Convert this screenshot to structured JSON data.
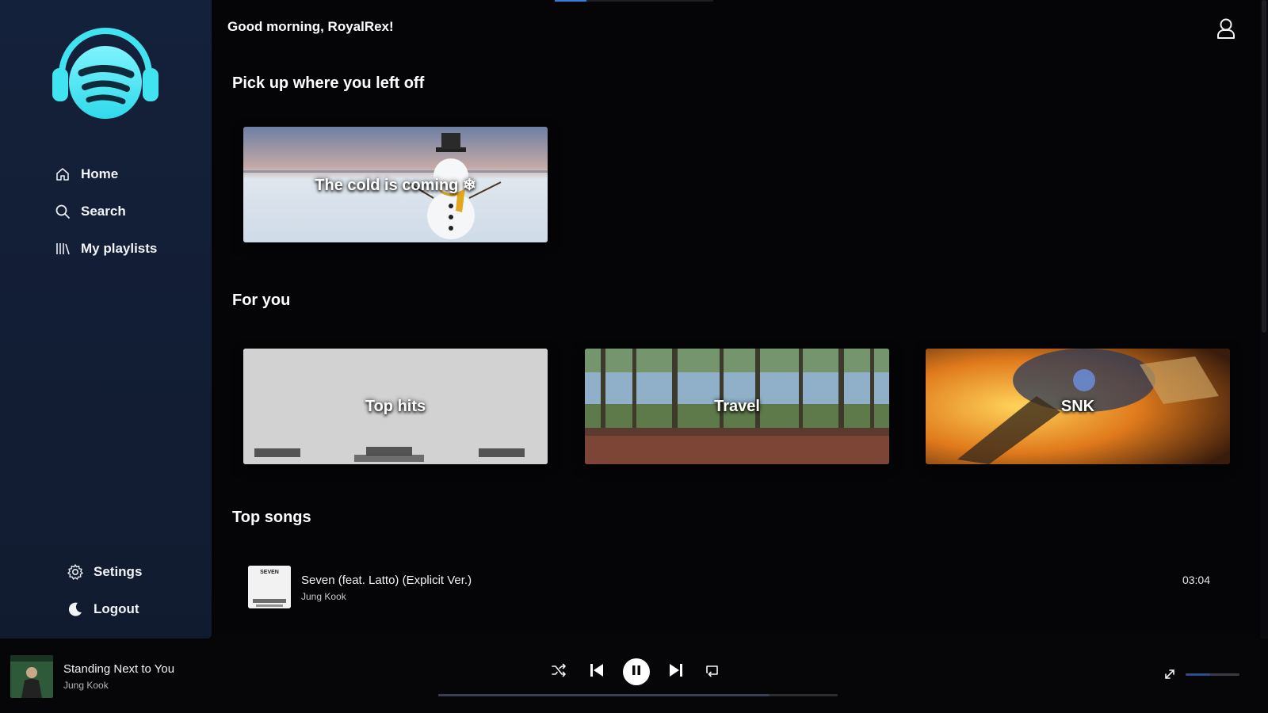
{
  "header": {
    "greeting": "Good morning, RoyalRex!"
  },
  "sidebar": {
    "nav": [
      {
        "label": "Home",
        "icon": "home-icon"
      },
      {
        "label": "Search",
        "icon": "search-icon"
      },
      {
        "label": "My playlists",
        "icon": "library-icon"
      }
    ],
    "bottom": [
      {
        "label": "Setings",
        "icon": "gear-icon"
      },
      {
        "label": "Logout",
        "icon": "moon-icon"
      }
    ]
  },
  "sections": {
    "continue": {
      "title": "Pick up where you left off",
      "cards": [
        {
          "label": "The cold is coming ❄"
        }
      ]
    },
    "for_you": {
      "title": "For you",
      "cards": [
        {
          "label": "Top hits"
        },
        {
          "label": "Travel"
        },
        {
          "label": "SNK"
        }
      ]
    },
    "top_songs": {
      "title": "Top songs",
      "songs": [
        {
          "title": "Seven (feat. Latto) (Explicit Ver.)",
          "artist": "Jung Kook",
          "duration": "03:04",
          "thumb_text": "SEVEN"
        }
      ]
    }
  },
  "player": {
    "title": "Standing Next to You",
    "artist": "Jung Kook",
    "progress_fraction": 0.83,
    "volume_fraction": 0.45,
    "state": "playing"
  },
  "colors": {
    "sidebar_bg": "#14213a",
    "accent": "#2ee6f0",
    "background": "#050507"
  }
}
